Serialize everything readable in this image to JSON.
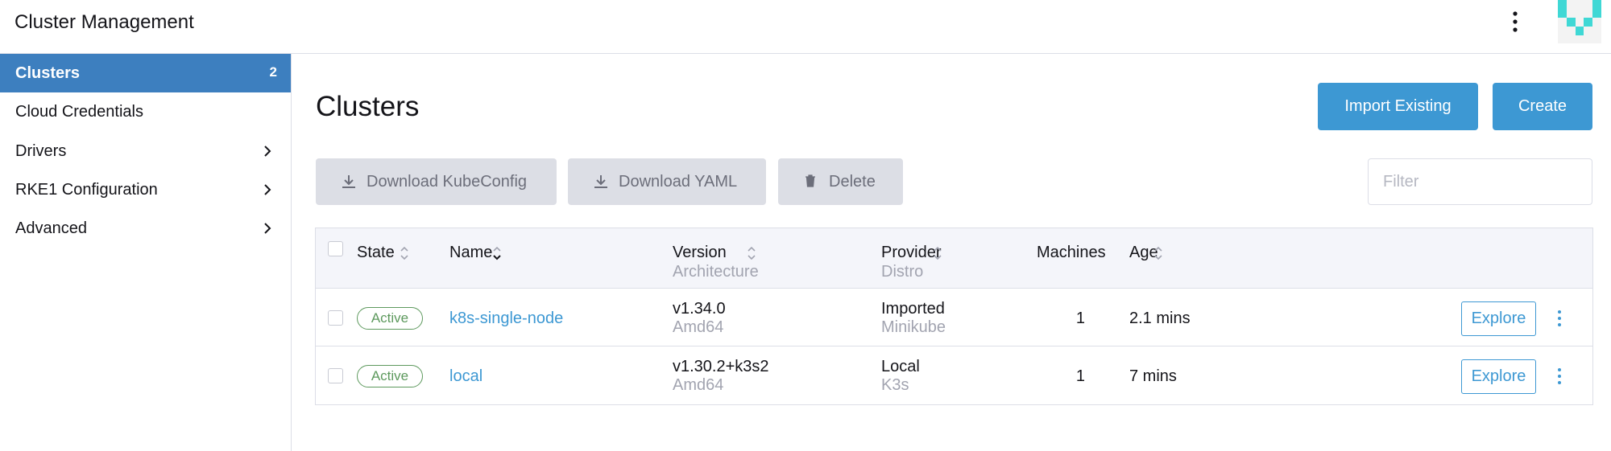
{
  "header": {
    "title": "Cluster Management",
    "menu_icon": "kebab-vertical-icon",
    "avatar_icon": "user-avatar-icon"
  },
  "sidebar": {
    "items": [
      {
        "label": "Clusters",
        "count": "2",
        "active": true
      },
      {
        "label": "Cloud Credentials"
      },
      {
        "label": "Drivers",
        "expandable": true
      },
      {
        "label": "RKE1 Configuration",
        "expandable": true
      },
      {
        "label": "Advanced",
        "expandable": true
      }
    ]
  },
  "main": {
    "title": "Clusters",
    "actions": {
      "import_label": "Import Existing",
      "create_label": "Create"
    },
    "bulk": {
      "download_kubeconfig": "Download KubeConfig",
      "download_yaml": "Download YAML",
      "delete": "Delete"
    },
    "filter": {
      "placeholder": "Filter",
      "value": ""
    }
  },
  "table": {
    "headers": {
      "state": "State",
      "name": "Name",
      "version": "Version",
      "architecture": "Architecture",
      "provider": "Provider",
      "distro": "Distro",
      "machines": "Machines",
      "age": "Age"
    },
    "rows": [
      {
        "state": "Active",
        "name": "k8s-single-node",
        "version": "v1.34.0",
        "architecture": "Amd64",
        "provider": "Imported",
        "distro": "Minikube",
        "machines": "1",
        "age": "2.1 mins",
        "action": "Explore"
      },
      {
        "state": "Active",
        "name": "local",
        "version": "v1.30.2+k3s2",
        "architecture": "Amd64",
        "provider": "Local",
        "distro": "K3s",
        "machines": "1",
        "age": "7 mins",
        "action": "Explore"
      }
    ]
  },
  "colors": {
    "primary": "#3d98d3",
    "sidebar_active": "#3d7fbf",
    "active_badge": "#5d995d",
    "avatar": "#3fd8d5"
  }
}
